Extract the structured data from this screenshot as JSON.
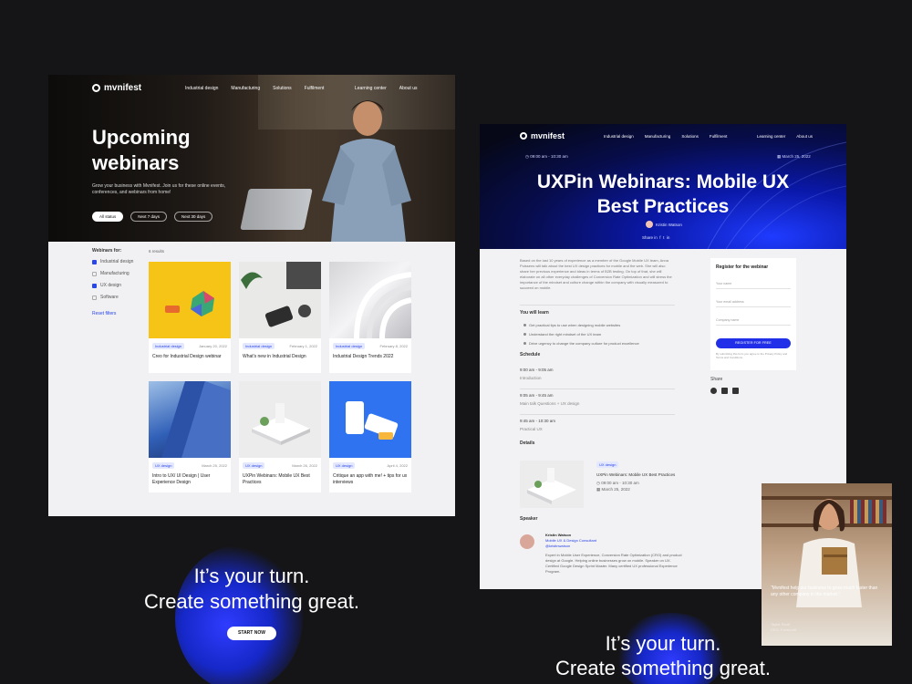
{
  "left": {
    "logo": "mvnifest",
    "nav_links": [
      "Industrial design",
      "Manufacturing",
      "Solutions",
      "Fulfilment"
    ],
    "nav_right": [
      "Learning center",
      "About us"
    ],
    "hero_title": "Upcoming webinars",
    "hero_sub": "Grow your business with Mvnifest. Join us for these online events, conferences, and webinars from home!",
    "chips": [
      "All status",
      "Next 7 days",
      "Next 30 days"
    ],
    "filters": {
      "title": "Webinars for:",
      "items": [
        {
          "label": "Industrial design",
          "checked": true
        },
        {
          "label": "Manufacturing",
          "checked": false
        },
        {
          "label": "UX design",
          "checked": true
        },
        {
          "label": "Software",
          "checked": false
        }
      ],
      "reset": "Reset filters"
    },
    "results": "6 results",
    "cards": [
      {
        "tag": "Industrial design",
        "date": "January 20, 2022",
        "title": "Creo for Industrial Design webinar"
      },
      {
        "tag": "Industrial design",
        "date": "February 1, 2022",
        "title": "What's new in Industrial Design"
      },
      {
        "tag": "Industrial design",
        "date": "February 8, 2022",
        "title": "Industrial Design Trends 2022"
      },
      {
        "tag": "UX design",
        "date": "March 25, 2022",
        "title": "Intro to UX/ UI Design | User Experience Design"
      },
      {
        "tag": "UX design",
        "date": "March 26, 2022",
        "title": "UXPin Webinars: Mobile UX Best Practices"
      },
      {
        "tag": "UX design",
        "date": "April 4, 2022",
        "title": "Critique an app with me! + tips for ux interviews"
      }
    ],
    "closing_line1": "It’s your turn.",
    "closing_line2": "Create something great.",
    "start_button": "START NOW"
  },
  "right": {
    "logo": "mvnifest",
    "nav_links": [
      "Industrial design",
      "Manufacturing",
      "Solutions",
      "Fulfilment"
    ],
    "nav_right": [
      "Learning center",
      "About us"
    ],
    "time": "09:00 am - 10:30 am",
    "date": "March 25, 2022",
    "title": "UXPin Webinars: Mobile UX Best Practices",
    "author": "Kristin Watson",
    "share_line": "Share in",
    "intro": "Based on the last 10 years of experience as a member of the Google Mobile UX team, Anna Puissens will talk about the best UX design practices for mobile and the web. She will also share her previous experience and ideas in terms of B2B testing. On top of that, she will elaborate on all other everyday challenges of Conversion Rate Optimization and will stress the importance of the mindset and culture change within the company with visually measured to succeed on mobile.",
    "learn_title": "You will learn",
    "learn_items": [
      "Get practical tips to use when designing mobile websites",
      "Understand the right mindset of the UX team",
      "Drive urgency to change the company culture for product excellence"
    ],
    "schedule_title": "Schedule",
    "schedule": [
      {
        "time": "9:00 am - 9:05 am",
        "label": "Introduction"
      },
      {
        "time": "9:05 am - 9:45 am",
        "label": "Main talk Questions + UX design"
      },
      {
        "time": "9:45 am - 10:30 am",
        "label": "Practical UX"
      }
    ],
    "details_title": "Details",
    "detail_tag": "UX design",
    "detail_title": "UXPin Webinars: Mobile UX Best Practices",
    "detail_time": "09:00 am - 10:30 am",
    "detail_date": "March 25, 2022",
    "speaker_title": "Speaker",
    "speaker_name": "Kristin Watson",
    "speaker_role": "Mobile UX & Design Consultant",
    "speaker_handle": "@kristinwatson",
    "speaker_bio": "Expert in Mobile User Experience, Conversion Rate Optimization (CRO) and product design at Google. Helping online businesses grow on mobile. Speaker on UX. Certified Google Design Sprint Master. Many certified UX professional Experience Program.",
    "register_title": "Register for the webinar",
    "fields": [
      "Your name",
      "Your email address",
      "Company name"
    ],
    "register_button": "REGISTER FOR FREE",
    "legal": "By submitting this form you agree to the Privacy Policy and Terms and Conditions.",
    "share_title": "Share",
    "closing_line1": "It’s your turn.",
    "closing_line2": "Create something great."
  },
  "testimonial": {
    "quote": "“Mvnifest help our business to grow much faster than any other company in the market.”",
    "name": "Taylor Scott",
    "role": "CEO, Formcraft"
  },
  "colors": {
    "accent": "#2a45e8",
    "page_bg": "#151518",
    "hero_blue": "#0a18a8"
  }
}
